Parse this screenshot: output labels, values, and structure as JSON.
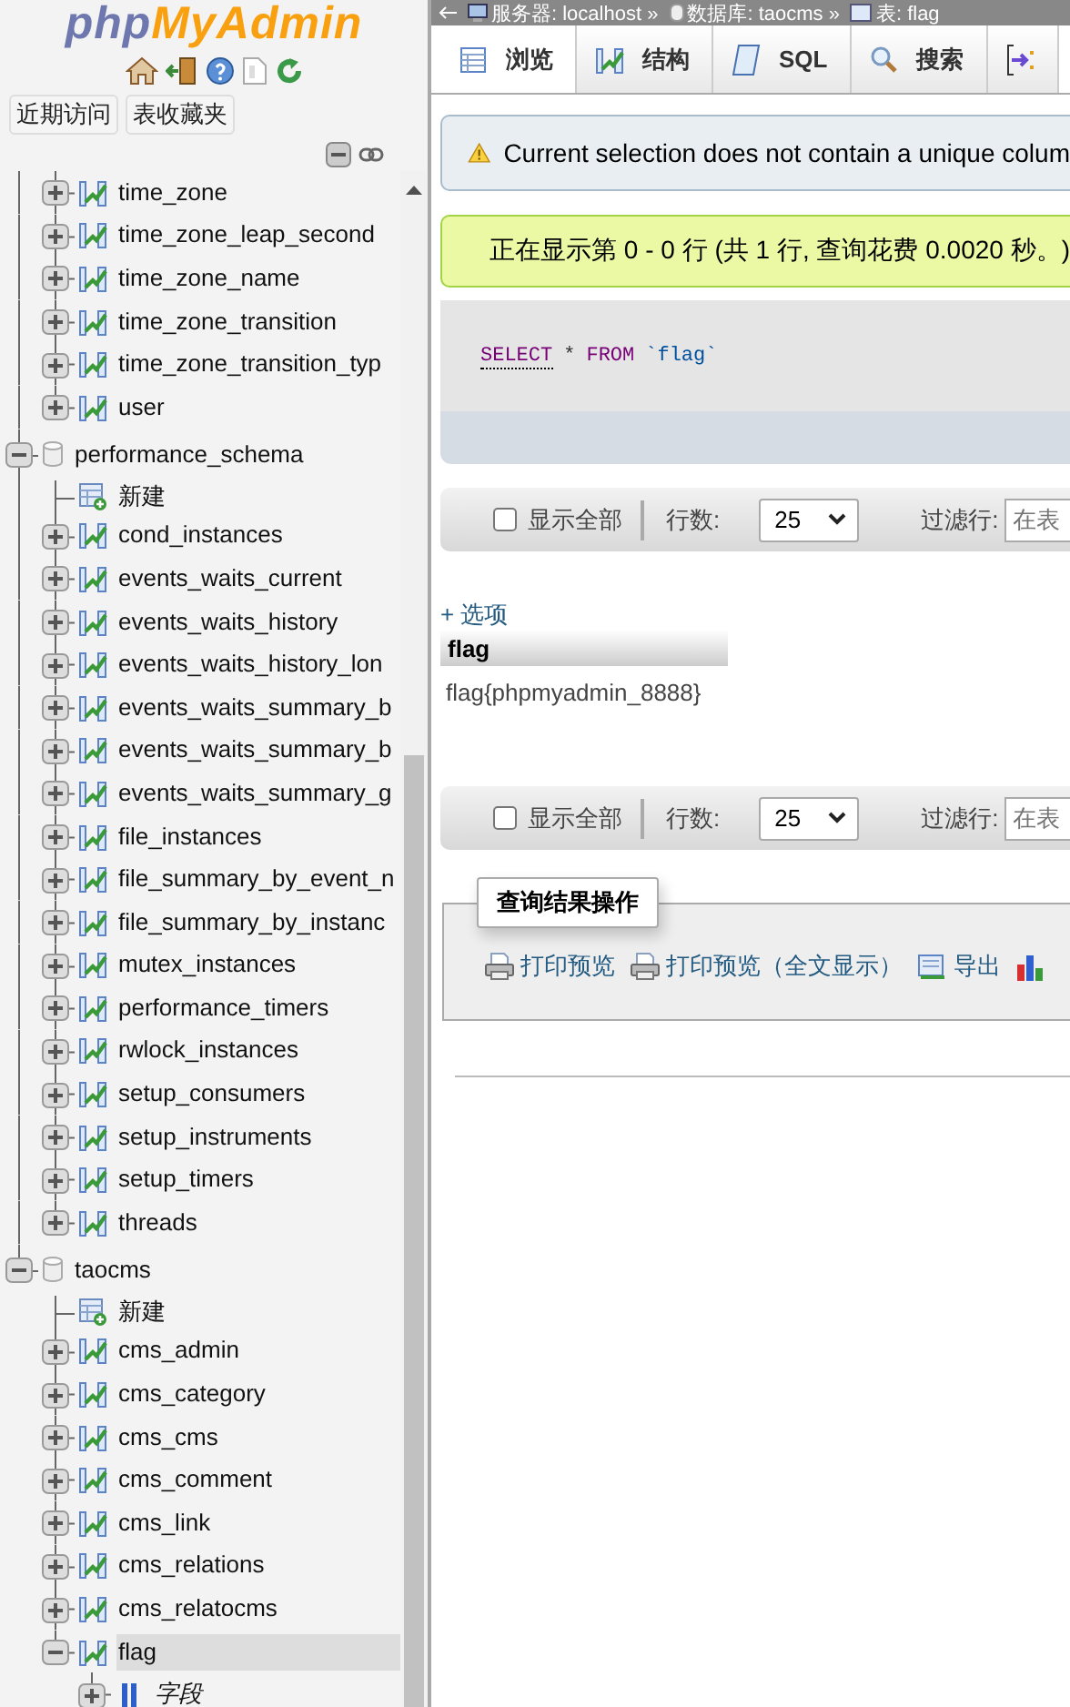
{
  "sidebar": {
    "logo": {
      "part_1": "php",
      "part_2": "MyAdmin"
    },
    "buttons": [
      {
        "label": "近期访问"
      },
      {
        "label": "表收藏夹"
      }
    ],
    "tree": [
      {
        "children": [
          {
            "kind": "table",
            "name": "time_zone",
            "expanded": false,
            "selected": false
          },
          {
            "kind": "table",
            "name": "time_zone_leap_second",
            "expanded": false,
            "selected": false
          },
          {
            "kind": "table",
            "name": "time_zone_name",
            "expanded": false,
            "selected": false
          },
          {
            "kind": "table",
            "name": "time_zone_transition",
            "expanded": false,
            "selected": false
          },
          {
            "kind": "table",
            "name": "time_zone_transition_typ",
            "expanded": false,
            "selected": false
          },
          {
            "kind": "table",
            "name": "user",
            "expanded": false,
            "selected": false
          }
        ]
      },
      {
        "kind": "database",
        "name": "performance_schema",
        "expanded": true,
        "children": [
          {
            "kind": "new",
            "name": "新建"
          },
          {
            "kind": "table",
            "name": "cond_instances",
            "expanded": false,
            "selected": false
          },
          {
            "kind": "table",
            "name": "events_waits_current",
            "expanded": false,
            "selected": false
          },
          {
            "kind": "table",
            "name": "events_waits_history",
            "expanded": false,
            "selected": false
          },
          {
            "kind": "table",
            "name": "events_waits_history_lon",
            "expanded": false,
            "selected": false
          },
          {
            "kind": "table",
            "name": "events_waits_summary_b",
            "expanded": false,
            "selected": false
          },
          {
            "kind": "table",
            "name": "events_waits_summary_b",
            "expanded": false,
            "selected": false
          },
          {
            "kind": "table",
            "name": "events_waits_summary_g",
            "expanded": false,
            "selected": false
          },
          {
            "kind": "table",
            "name": "file_instances",
            "expanded": false,
            "selected": false
          },
          {
            "kind": "table",
            "name": "file_summary_by_event_n",
            "expanded": false,
            "selected": false
          },
          {
            "kind": "table",
            "name": "file_summary_by_instanc",
            "expanded": false,
            "selected": false
          },
          {
            "kind": "table",
            "name": "mutex_instances",
            "expanded": false,
            "selected": false
          },
          {
            "kind": "table",
            "name": "performance_timers",
            "expanded": false,
            "selected": false
          },
          {
            "kind": "table",
            "name": "rwlock_instances",
            "expanded": false,
            "selected": false
          },
          {
            "kind": "table",
            "name": "setup_consumers",
            "expanded": false,
            "selected": false
          },
          {
            "kind": "table",
            "name": "setup_instruments",
            "expanded": false,
            "selected": false
          },
          {
            "kind": "table",
            "name": "setup_timers",
            "expanded": false,
            "selected": false
          },
          {
            "kind": "table",
            "name": "threads",
            "expanded": false,
            "selected": false
          }
        ]
      },
      {
        "kind": "database",
        "name": "taocms",
        "expanded": true,
        "children": [
          {
            "kind": "new",
            "name": "新建"
          },
          {
            "kind": "table",
            "name": "cms_admin",
            "expanded": false,
            "selected": false
          },
          {
            "kind": "table",
            "name": "cms_category",
            "expanded": false,
            "selected": false
          },
          {
            "kind": "table",
            "name": "cms_cms",
            "expanded": false,
            "selected": false
          },
          {
            "kind": "table",
            "name": "cms_comment",
            "expanded": false,
            "selected": false
          },
          {
            "kind": "table",
            "name": "cms_link",
            "expanded": false,
            "selected": false
          },
          {
            "kind": "table",
            "name": "cms_relations",
            "expanded": false,
            "selected": false
          },
          {
            "kind": "table",
            "name": "cms_relatocms",
            "expanded": false,
            "selected": false
          },
          {
            "kind": "table",
            "name": "flag",
            "expanded": true,
            "selected": true,
            "children": [
              {
                "kind": "columns",
                "name": "字段",
                "expanded": false
              }
            ]
          }
        ]
      }
    ]
  },
  "breadcrumb": [
    {
      "kind": "server",
      "label": "服务器: localhost »"
    },
    {
      "kind": "database",
      "label": "数据库: taocms »"
    },
    {
      "kind": "table",
      "label": "表: flag"
    }
  ],
  "tabs": [
    {
      "kind": "browse",
      "label": "浏览",
      "selected": true
    },
    {
      "kind": "structure",
      "label": "结构",
      "selected": false
    },
    {
      "kind": "sql",
      "label": "SQL",
      "selected": false
    },
    {
      "kind": "search",
      "label": "搜索",
      "selected": false
    },
    {
      "kind": "insert",
      "selected": false
    }
  ],
  "messages": [
    {
      "kind": "warning",
      "text": "Current selection does not contain a unique colum"
    },
    {
      "kind": "success",
      "text": "正在显示第 0 - 0 行 (共 1 行, 查询花费 0.0020 秒。)"
    }
  ],
  "sql": [
    {
      "kind": "statement",
      "text": "SELECT"
    },
    {
      "kind": "operator",
      "text": "*"
    },
    {
      "kind": "keyword",
      "text": "FROM"
    },
    {
      "kind": "identifier",
      "text": "`flag`"
    }
  ],
  "navigation_bars": [
    {
      "show_all": {
        "label": "显示全部",
        "checked": false
      },
      "rows": {
        "label": "行数:",
        "value": "25"
      },
      "filter": {
        "label": "过滤行:",
        "placeholder": "在表"
      }
    },
    {
      "show_all": {
        "label": "显示全部",
        "checked": false
      },
      "rows": {
        "label": "行数:",
        "value": "25"
      },
      "filter": {
        "label": "过滤行:",
        "placeholder": "在表"
      }
    }
  ],
  "options_link": "+ 选项",
  "results": {
    "columns": [
      "flag"
    ],
    "rows": [
      [
        "flag{phpmyadmin_8888}"
      ]
    ]
  },
  "query_operations": {
    "legend": "查询结果操作",
    "links": [
      {
        "kind": "print",
        "label": "打印预览"
      },
      {
        "kind": "print",
        "label": "打印预览（全文显示）"
      },
      {
        "kind": "export",
        "label": "导出"
      },
      {
        "kind": "chart"
      }
    ]
  }
}
